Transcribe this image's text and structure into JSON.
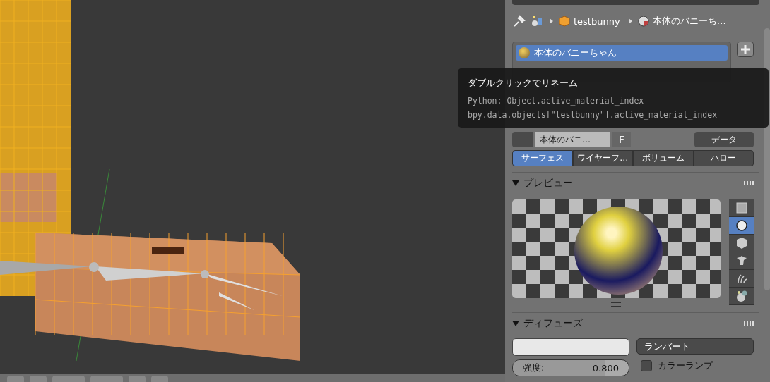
{
  "breadcrumb": {
    "object": "testbunny",
    "material": "本体のバニーち…"
  },
  "material_slots": [
    {
      "name": "本体のバニーちゃん",
      "selected": true
    }
  ],
  "material_selector": {
    "name": "本体のバニ…",
    "fake_user": "F",
    "link": "データ"
  },
  "shading_tabs": [
    {
      "label": "サーフェス",
      "selected": true
    },
    {
      "label": "ワイヤーフ…",
      "selected": false
    },
    {
      "label": "ボリューム",
      "selected": false
    },
    {
      "label": "ハロー",
      "selected": false
    }
  ],
  "preview": {
    "title": "プレビュー",
    "expanded": true,
    "shapes": [
      {
        "kind": "plane",
        "selected": false
      },
      {
        "kind": "sphere",
        "selected": true
      },
      {
        "kind": "cube",
        "selected": false
      },
      {
        "kind": "monkey",
        "selected": false
      },
      {
        "kind": "hair",
        "selected": false
      },
      {
        "kind": "sky",
        "selected": false
      }
    ]
  },
  "diffuse": {
    "title": "ディフューズ",
    "expanded": true,
    "shader": "ランバート",
    "intensity_label": "強度:",
    "intensity": "0.800",
    "level": 0.8,
    "color_ramp": {
      "label": "カラーランプ",
      "checked": false
    }
  },
  "tooltip": {
    "title": "ダブルクリックでリネーム",
    "python": [
      "Python: Object.active_material_index",
      "bpy.data.objects[\"testbunny\"].active_material_index"
    ]
  }
}
